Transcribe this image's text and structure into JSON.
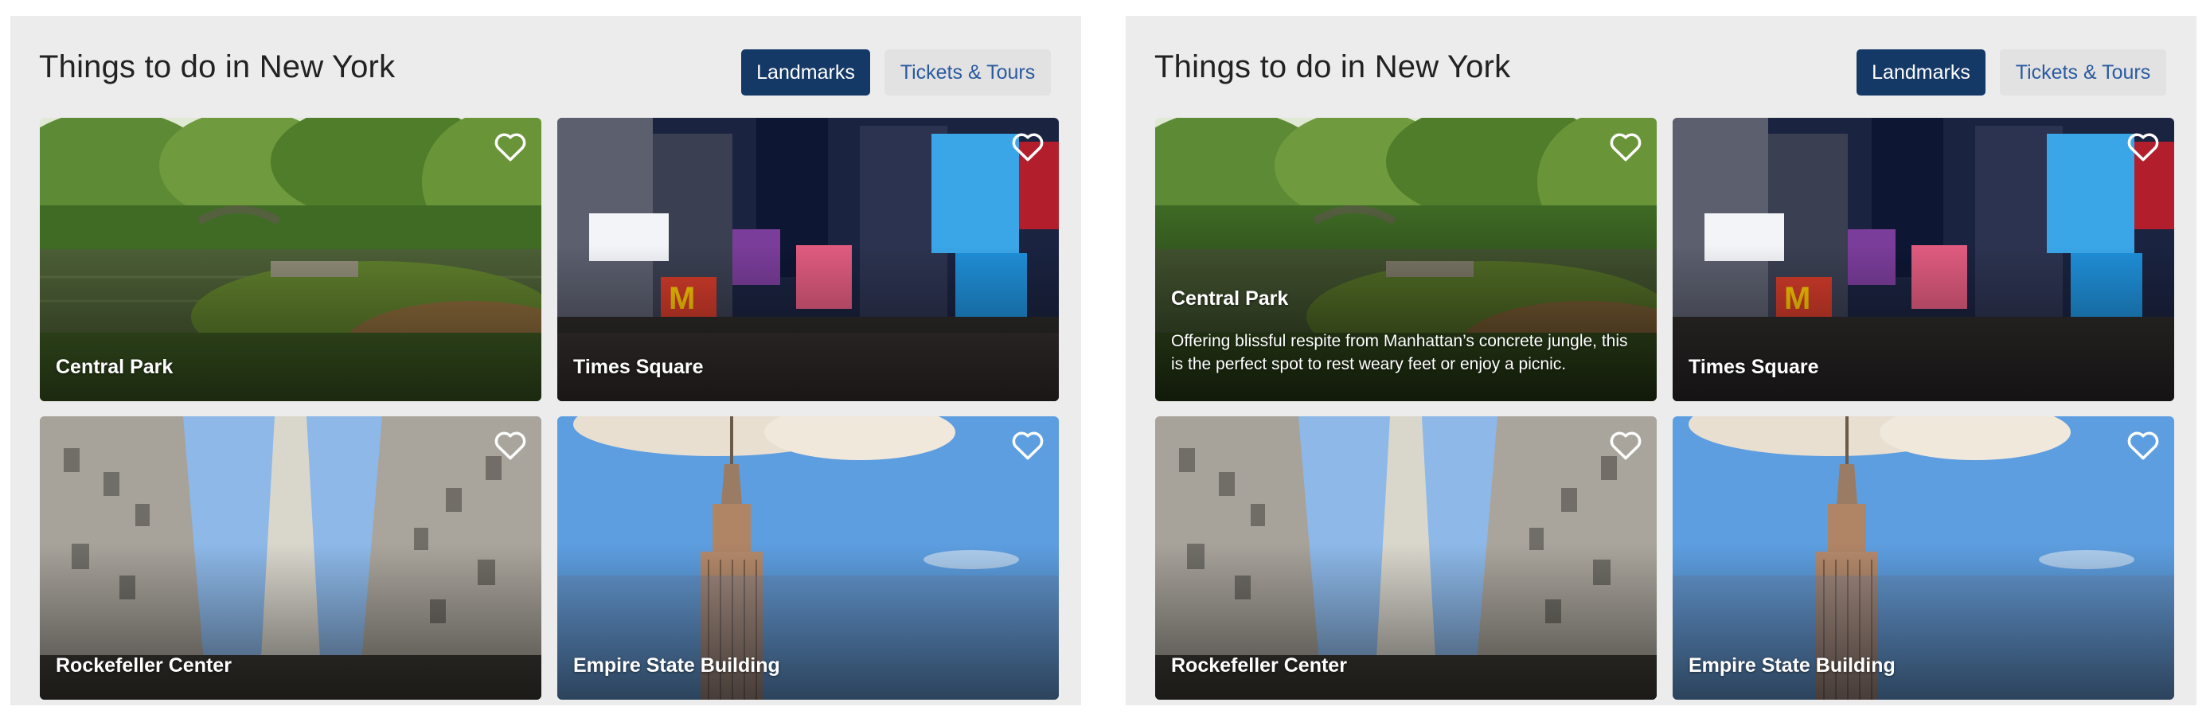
{
  "panels": [
    {
      "heading": "Things to do in New York",
      "tabs": [
        {
          "label": "Landmarks",
          "active": true
        },
        {
          "label": "Tickets & Tours",
          "active": false
        }
      ],
      "cards": [
        {
          "title": "Central Park",
          "description": "",
          "scene": "park"
        },
        {
          "title": "Times Square",
          "description": "",
          "scene": "times"
        },
        {
          "title": "Rockefeller Center",
          "description": "",
          "scene": "rock"
        },
        {
          "title": "Empire State Building",
          "description": "",
          "scene": "empire"
        }
      ]
    },
    {
      "heading": "Things to do in New York",
      "tabs": [
        {
          "label": "Landmarks",
          "active": true
        },
        {
          "label": "Tickets & Tours",
          "active": false
        }
      ],
      "cards": [
        {
          "title": "Central Park",
          "description": "Offering blissful respite from Manhattan’s concrete jungle, this is the perfect spot to rest weary feet or enjoy a picnic.",
          "scene": "park"
        },
        {
          "title": "Times Square",
          "description": "",
          "scene": "times"
        },
        {
          "title": "Rockefeller Center",
          "description": "",
          "scene": "rock"
        },
        {
          "title": "Empire State Building",
          "description": "",
          "scene": "empire"
        }
      ]
    }
  ],
  "icons": {
    "favorite": "heart-outline-icon"
  },
  "colors": {
    "accent": "#153966",
    "link": "#2a5aa0",
    "panel_bg": "#ececec",
    "tab_inactive_bg": "#e2e2e2"
  }
}
